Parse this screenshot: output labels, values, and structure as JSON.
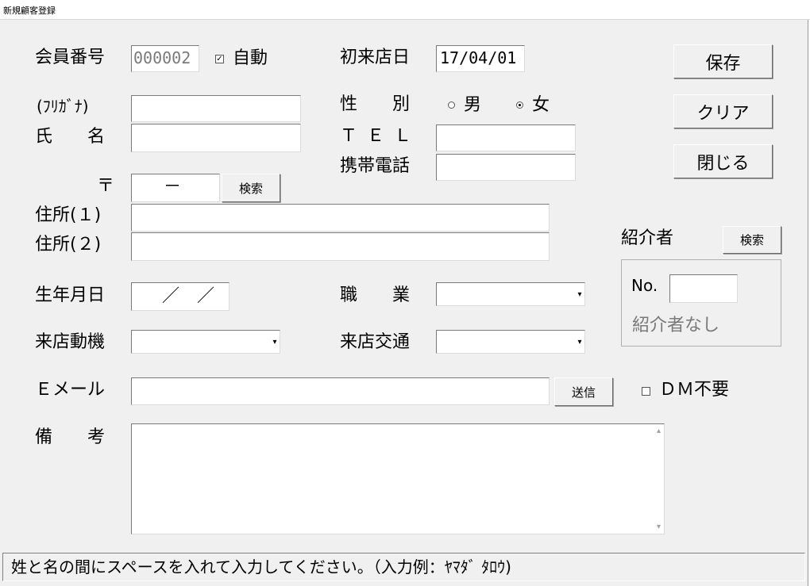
{
  "window": {
    "title": "新規顧客登録"
  },
  "form": {
    "member_no_label": "会員番号",
    "member_no_value": "000002",
    "auto_label": "自動",
    "auto_checked": true,
    "first_visit_label": "初来店日",
    "first_visit_value": "17/04/01",
    "furigana_label": "(ﾌﾘｶﾞﾅ)",
    "name_label": "氏　　名",
    "gender_label": "性　　別",
    "gender_male": "男",
    "gender_female": "女",
    "gender_selected": "女",
    "tel_label": "ＴＥＬ",
    "mobile_label": "携帯電話",
    "postal_label": "〒",
    "postal_value": "－",
    "postal_search": "検索",
    "address1_label": "住所(１)",
    "address2_label": "住所(２)",
    "birthday_label": "生年月日",
    "birthday_value": "／　／",
    "job_label": "職　　業",
    "motive_label": "来店動機",
    "transport_label": "来店交通",
    "email_label": "Ｅメール",
    "send_button": "送信",
    "dm_label": "ＤＭ不要",
    "dm_checked": false,
    "notes_label": "備　　考"
  },
  "buttons": {
    "save": "保存",
    "clear": "クリア",
    "close": "閉じる"
  },
  "referrer": {
    "label": "紹介者",
    "search_button": "検索",
    "no_label": "No.",
    "none_text": "紹介者なし"
  },
  "status": {
    "message": "姓と名の間にスペースを入れて入力してください。（入力例：ﾔﾏﾀﾞ ﾀﾛｳ)"
  }
}
